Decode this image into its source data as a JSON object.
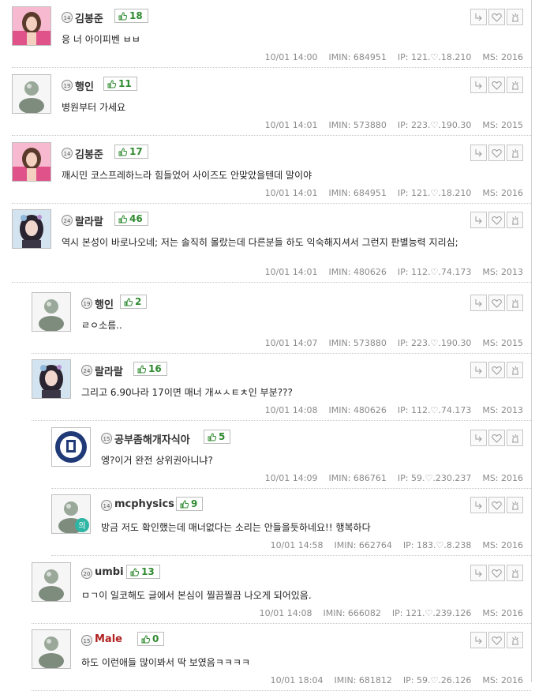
{
  "comments": [
    {
      "level": "14",
      "nick": "김봉준",
      "likes": "18",
      "text": "응 너 아이피벤 ㅂㅂ",
      "date": "10/01 14:00",
      "imin": "IMIN: 684951",
      "ip": "IP: 121.♡.18.210",
      "ms": "MS: 2016",
      "avatar": "girl-pink"
    },
    {
      "level": "19",
      "nick": "행인",
      "likes": "11",
      "text": "병원부터 가세요",
      "date": "10/01 14:01",
      "imin": "IMIN: 573880",
      "ip": "IP: 223.♡.190.30",
      "ms": "MS: 2015",
      "avatar": "default"
    },
    {
      "level": "14",
      "nick": "김봉준",
      "likes": "17",
      "text": "깨시민 코스프레하느라 힘들었어 사이즈도 안맞았을텐데 말이야",
      "date": "10/01 14:01",
      "imin": "IMIN: 684951",
      "ip": "IP: 121.♡.18.210",
      "ms": "MS: 2016",
      "avatar": "girl-pink"
    },
    {
      "level": "24",
      "nick": "랄라랄",
      "likes": "46",
      "text": "역시 본성이 바로나오네; 저는 솔직히 몰랐는데 다른분들 하도 익숙해지셔서 그런지 판별능력 지리심;",
      "date": "10/01 14:01",
      "imin": "IMIN: 480626",
      "ip": "IP: 112.♡.74.173",
      "ms": "MS: 2013",
      "avatar": "girl-dark"
    },
    {
      "level": "19",
      "nick": "행인",
      "likes": "2",
      "text": "ㄹㅇ소름..",
      "date": "10/01 14:07",
      "imin": "IMIN: 573880",
      "ip": "IP: 223.♡.190.30",
      "ms": "MS: 2015",
      "avatar": "default"
    },
    {
      "level": "24",
      "nick": "랄라랄",
      "likes": "16",
      "text": "그리고 6.90나라 17이면 매너 개ㅆㅅㅌㅊ인 부분???",
      "date": "10/01 14:08",
      "imin": "IMIN: 480626",
      "ip": "IP: 112.♡.74.173",
      "ms": "MS: 2013",
      "avatar": "girl-dark"
    },
    {
      "level": "15",
      "nick": "공부좀해개자식아",
      "likes": "5",
      "text": "엥?이거 완전 상위권아니냐?",
      "date": "10/01 14:09",
      "imin": "IMIN: 686761",
      "ip": "IP: 59.♡.230.237",
      "ms": "MS: 2016",
      "avatar": "emblem"
    },
    {
      "level": "14",
      "nick": "mcphysics",
      "likes": "9",
      "text": "방금 저도 확인했는데 매너없다는 소리는 안들을듯하네요!! 행복하다",
      "date": "10/01 14:58",
      "imin": "IMIN: 662764",
      "ip": "IP: 183.♡.8.238",
      "ms": "MS: 2016",
      "avatar": "default-badge",
      "badge": "의"
    },
    {
      "level": "20",
      "nick": "umbi",
      "likes": "13",
      "text": "ㅁㄱ이 일코해도 글에서 본심이 찔끔찔끔 나오게 되어있음.",
      "date": "10/01 14:08",
      "imin": "IMIN: 666082",
      "ip": "IP: 121.♡.239.126",
      "ms": "MS: 2016",
      "avatar": "default"
    },
    {
      "level": "15",
      "nick": "Male",
      "likes": "0",
      "text": "하도 이런애들 많이봐서 딱 보였음ㅋㅋㅋㅋ",
      "date": "10/01 18:04",
      "imin": "IMIN: 681812",
      "ip": "IP: 59.♡.26.126",
      "ms": "MS: 2016",
      "avatar": "default"
    }
  ]
}
